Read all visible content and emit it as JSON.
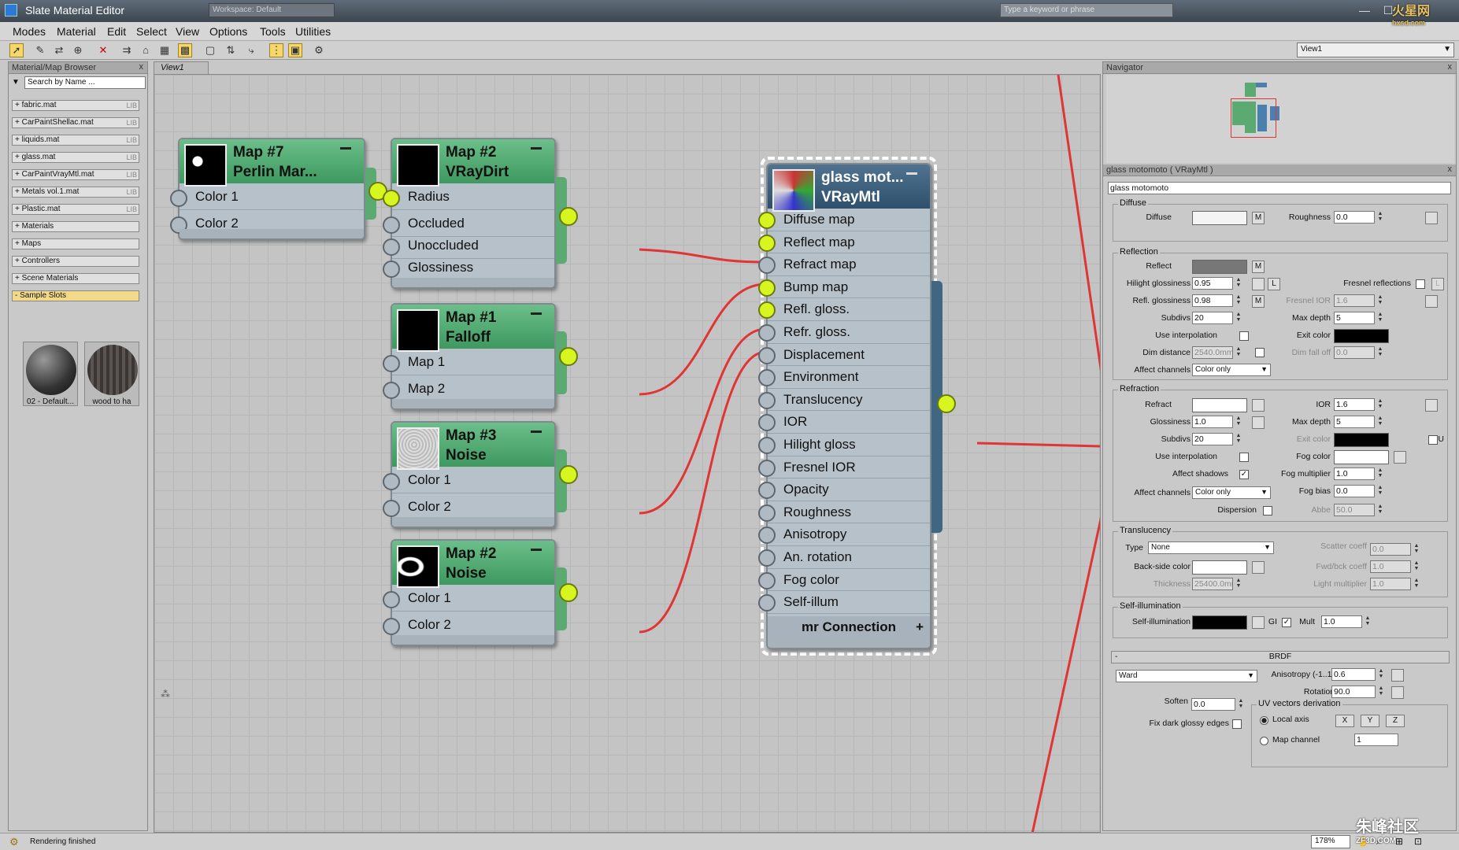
{
  "window": {
    "title": "Slate Material Editor",
    "workspace": "Workspace: Default",
    "search_placeholder": "Type a keyword or phrase",
    "minimize": "—",
    "maximize": "☐",
    "close": "✕"
  },
  "menu": [
    "Modes",
    "Material",
    "Edit",
    "Select",
    "View",
    "Options",
    "Tools",
    "Utilities"
  ],
  "toolbar": {
    "view_select": "View1"
  },
  "browser": {
    "title": "Material/Map Browser",
    "close": "x",
    "search_placeholder": "Search by Name ...",
    "libraries": [
      {
        "label": "+ fabric.mat",
        "tag": "LIB"
      },
      {
        "label": "+ CarPaintShellac.mat",
        "tag": "LIB"
      },
      {
        "label": "+ liquids.mat",
        "tag": "LIB"
      },
      {
        "label": "+ glass.mat",
        "tag": "LIB"
      },
      {
        "label": "+ CarPaintVrayMtl.mat",
        "tag": "LIB"
      },
      {
        "label": "+ Metals vol.1.mat",
        "tag": "LIB"
      },
      {
        "label": "+ Plastic.mat",
        "tag": "LIB"
      },
      {
        "label": "+ Materials",
        "tag": ""
      },
      {
        "label": "+ Maps",
        "tag": ""
      },
      {
        "label": "+ Controllers",
        "tag": ""
      },
      {
        "label": "+ Scene Materials",
        "tag": ""
      },
      {
        "label": "- Sample Slots",
        "tag": ""
      }
    ],
    "slots": [
      "02 - Default...",
      "wood to ha"
    ]
  },
  "view_tab": "View1",
  "nodes": {
    "map7": {
      "title1": "Map #7",
      "title2": "Perlin Mar...",
      "slots": [
        "Color 1",
        "Color 2"
      ]
    },
    "map2dirt": {
      "title1": "Map #2",
      "title2": "VRayDirt",
      "slots": [
        "Radius",
        "Occluded",
        "Unoccluded",
        "Glossiness"
      ]
    },
    "map1": {
      "title1": "Map #1",
      "title2": "Falloff",
      "slots": [
        "Map 1",
        "Map 2"
      ]
    },
    "map3": {
      "title1": "Map #3",
      "title2": "Noise",
      "slots": [
        "Color 1",
        "Color 2"
      ]
    },
    "map2noise": {
      "title1": "Map #2",
      "title2": "Noise",
      "slots": [
        "Color 1",
        "Color 2"
      ]
    },
    "glass": {
      "title1": "glass mot...",
      "title2": "VRayMtl",
      "slots": [
        "Diffuse map",
        "Reflect map",
        "Refract map",
        "Bump map",
        "Refl. gloss.",
        "Refr. gloss.",
        "Displacement",
        "Environment",
        "Translucency",
        "IOR",
        "Hilight gloss",
        "Fresnel IOR",
        "Opacity",
        "Roughness",
        "Anisotropy",
        "An. rotation",
        "Fog color",
        "Self-illum"
      ],
      "footer": "mr Connection",
      "footer_plus": "+"
    }
  },
  "navigator": {
    "title": "Navigator",
    "close": "x"
  },
  "params": {
    "title": "glass motomoto  ( VRayMtl )",
    "close": "x",
    "name": "glass motomoto",
    "diffuse_group": "Diffuse",
    "diffuse": "Diffuse",
    "roughness": "Roughness",
    "roughness_val": "0.0",
    "m": "M",
    "l": "L",
    "reflection_group": "Reflection",
    "reflect": "Reflect",
    "hilight_gloss": "Hilight glossiness",
    "hilight_gloss_val": "0.95",
    "fresnel_refl": "Fresnel reflections",
    "refl_gloss": "Refl. glossiness",
    "refl_gloss_val": "0.98",
    "fresnel_ior": "Fresnel IOR",
    "fresnel_ior_val": "1.6",
    "subdivs": "Subdivs",
    "subdivs_val": "20",
    "max_depth": "Max depth",
    "max_depth_val": "5",
    "use_interp": "Use interpolation",
    "exit_color": "Exit color",
    "dim_distance": "Dim distance",
    "dim_distance_val": "2540.0mm",
    "dim_falloff": "Dim fall off",
    "dim_falloff_val": "0.0",
    "affect_channels": "Affect channels",
    "affect_channels_val": "Color only",
    "refraction_group": "Refraction",
    "refract": "Refract",
    "ior": "IOR",
    "ior_val": "1.6",
    "glossiness": "Glossiness",
    "glossiness_val": "1.0",
    "r_max_depth_val": "5",
    "r_subdivs_val": "20",
    "r_exit_color": "Exit color",
    "u": "U",
    "fog_color": "Fog color",
    "affect_shadows": "Affect shadows",
    "check": "✓",
    "fog_mult": "Fog multiplier",
    "fog_mult_val": "1.0",
    "fog_bias": "Fog bias",
    "fog_bias_val": "0.0",
    "dispersion": "Dispersion",
    "abbe": "Abbe",
    "abbe_val": "50.0",
    "translucency_group": "Translucency",
    "type": "Type",
    "type_val": "None",
    "scatter": "Scatter coeff",
    "scatter_val": "0.0",
    "backside": "Back-side color",
    "fwdbck": "Fwd/bck coeff",
    "fwdbck_val": "1.0",
    "thickness": "Thickness",
    "thickness_val": "25400.0mm",
    "light_mult": "Light multiplier",
    "light_mult_val": "1.0",
    "selfillum_group": "Self-illumination",
    "selfillum": "Self-illumination",
    "gi": "GI",
    "mult": "Mult",
    "mult_val": "1.0",
    "brdf_title": "BRDF",
    "brdf_minus": "-",
    "brdf_type": "Ward",
    "anisotropy": "Anisotropy (-1..1)",
    "anisotropy_val": "0.6",
    "rotation": "Rotation",
    "rotation_val": "90.0",
    "soften": "Soften",
    "soften_val": "0.0",
    "uvderiv": "UV vectors derivation",
    "local_axis": "Local axis",
    "x": "X",
    "y": "Y",
    "z": "Z",
    "fix_dark": "Fix dark glossy edges",
    "map_channel": "Map channel",
    "map_channel_val": "1"
  },
  "status": {
    "text": "Rendering finished",
    "zoom": "178%"
  },
  "watermarks": {
    "top": "火星网",
    "top_sub": "hxsd.com",
    "bottom": "朱峰社区",
    "bottom_sub": "ZF3D.COM"
  },
  "colors": {
    "accent_green": "#5aaa72",
    "node_blue": "#2e506b",
    "socket_on": "#d7f51f",
    "wire": "#e03535"
  }
}
